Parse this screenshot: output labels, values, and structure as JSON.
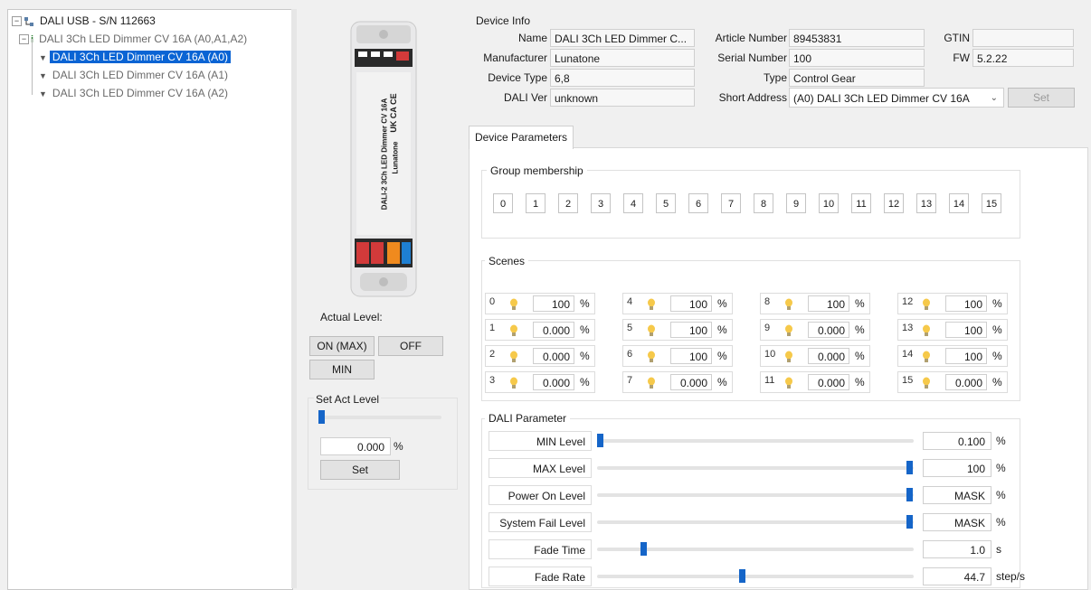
{
  "tree": {
    "root": "DALI USB - S/N 112663",
    "device": "DALI 3Ch LED Dimmer CV 16A (A0,A1,A2)",
    "children": [
      "DALI 3Ch LED Dimmer CV 16A (A0)",
      "DALI 3Ch LED Dimmer CV 16A (A1)",
      "DALI 3Ch LED Dimmer CV 16A (A2)"
    ]
  },
  "product_label": {
    "model": "DALI-2 3Ch LED Dimmer CV 16A",
    "brand": "Lunatone",
    "marks": "UK CA CE"
  },
  "actual_level": {
    "label": "Actual Level:",
    "on_max": "ON (MAX)",
    "off": "OFF",
    "min": "MIN"
  },
  "set_act_level": {
    "label": "Set Act Level",
    "value": "0.000",
    "unit": "%",
    "set": "Set",
    "slider_fraction": 0.0
  },
  "device_info": {
    "title": "Device Info",
    "name_label": "Name",
    "name": "DALI 3Ch LED Dimmer C...",
    "manufacturer_label": "Manufacturer",
    "manufacturer": "Lunatone",
    "device_type_label": "Device Type",
    "device_type": "6,8",
    "dali_ver_label": "DALI Ver",
    "dali_ver": "unknown",
    "article_label": "Article Number",
    "article": "89453831",
    "serial_label": "Serial Number",
    "serial": "100",
    "type_label": "Type",
    "type": "Control Gear",
    "short_address_label": "Short Address",
    "short_address": "(A0) DALI 3Ch LED Dimmer CV 16A",
    "gtin_label": "GTIN",
    "gtin": "",
    "fw_label": "FW",
    "fw": "5.2.22",
    "set": "Set"
  },
  "tab": {
    "label": "Device Parameters"
  },
  "group_membership": {
    "title": "Group membership",
    "groups": [
      "0",
      "1",
      "2",
      "3",
      "4",
      "5",
      "6",
      "7",
      "8",
      "9",
      "10",
      "11",
      "12",
      "13",
      "14",
      "15"
    ]
  },
  "scenes": {
    "title": "Scenes",
    "unit": "%",
    "items": [
      {
        "idx": "0",
        "value": "100"
      },
      {
        "idx": "1",
        "value": "0.000"
      },
      {
        "idx": "2",
        "value": "0.000"
      },
      {
        "idx": "3",
        "value": "0.000"
      },
      {
        "idx": "4",
        "value": "100"
      },
      {
        "idx": "5",
        "value": "100"
      },
      {
        "idx": "6",
        "value": "100"
      },
      {
        "idx": "7",
        "value": "0.000"
      },
      {
        "idx": "8",
        "value": "100"
      },
      {
        "idx": "9",
        "value": "0.000"
      },
      {
        "idx": "10",
        "value": "0.000"
      },
      {
        "idx": "11",
        "value": "0.000"
      },
      {
        "idx": "12",
        "value": "100"
      },
      {
        "idx": "13",
        "value": "100"
      },
      {
        "idx": "14",
        "value": "100"
      },
      {
        "idx": "15",
        "value": "0.000"
      }
    ]
  },
  "dali_parameter": {
    "title": "DALI Parameter",
    "rows": [
      {
        "label": "MIN Level",
        "value": "0.100",
        "unit": "%",
        "fraction": 0.0
      },
      {
        "label": "MAX Level",
        "value": "100",
        "unit": "%",
        "fraction": 1.0
      },
      {
        "label": "Power On Level",
        "value": "MASK",
        "unit": "%",
        "fraction": 1.0
      },
      {
        "label": "System Fail Level",
        "value": "MASK",
        "unit": "%",
        "fraction": 1.0
      },
      {
        "label": "Fade Time",
        "value": "1.0",
        "unit": "s",
        "fraction": 0.14
      },
      {
        "label": "Fade Rate",
        "value": "44.7",
        "unit": "step/s",
        "fraction": 0.46
      }
    ]
  },
  "colors": {
    "accent": "#1565c8",
    "selection": "#0a64d4",
    "terminal_red": "#d23a3a",
    "terminal_orange": "#f08a1e",
    "terminal_blue": "#1e7fd2"
  }
}
